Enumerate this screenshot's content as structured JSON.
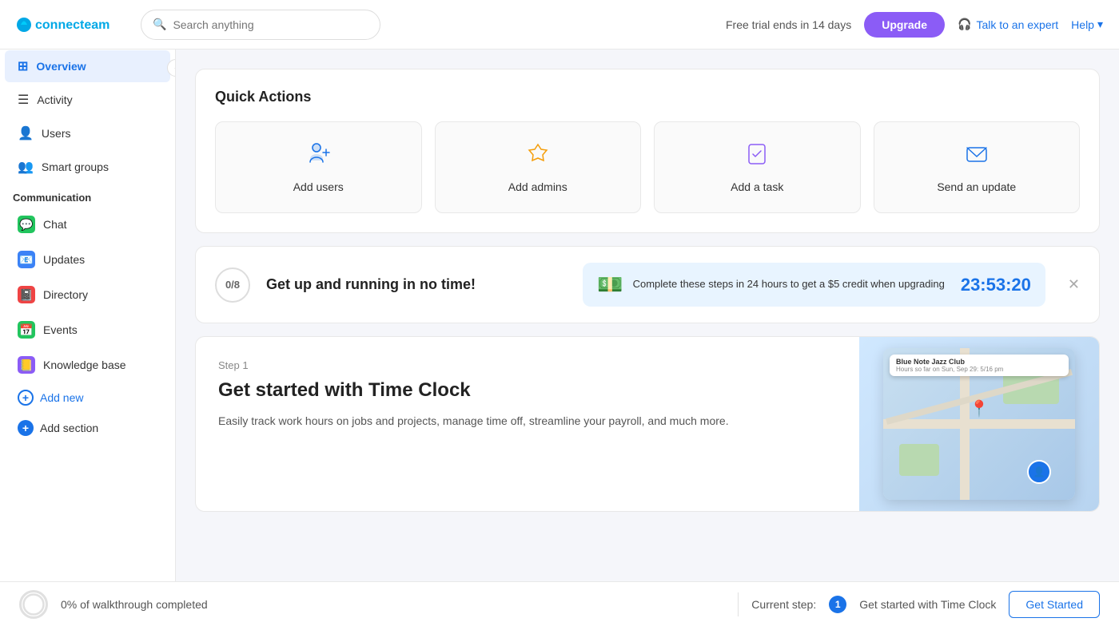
{
  "app": {
    "name": "connecteam",
    "logo_letters": "C"
  },
  "topnav": {
    "search_placeholder": "Search anything",
    "trial_text": "Free trial ends in 14 days",
    "upgrade_label": "Upgrade",
    "talk_expert_label": "Talk to an expert",
    "help_label": "Help"
  },
  "sidebar": {
    "overview_label": "Overview",
    "activity_label": "Activity",
    "users_label": "Users",
    "smart_groups_label": "Smart groups",
    "communication_label": "Communication",
    "chat_label": "Chat",
    "updates_label": "Updates",
    "directory_label": "Directory",
    "events_label": "Events",
    "knowledge_base_label": "Knowledge base",
    "add_new_label": "Add new",
    "add_section_label": "Add section"
  },
  "main": {
    "quick_actions_title": "Quick Actions",
    "quick_actions": [
      {
        "label": "Add users",
        "icon": "👤"
      },
      {
        "label": "Add admins",
        "icon": "👑"
      },
      {
        "label": "Add a task",
        "icon": "✅"
      },
      {
        "label": "Send an update",
        "icon": "✉️"
      }
    ],
    "progress_fraction": "0/8",
    "progress_text": "Get up and running in no time!",
    "credit_text": "Complete these steps in 24 hours to get a $5 credit when upgrading",
    "countdown": "23:53:20",
    "step_label": "Step 1",
    "step_title": "Get started with Time Clock",
    "step_desc": "Easily track work hours on jobs and projects, manage time off, streamline your payroll, and much more."
  },
  "bottombar": {
    "progress_pct": "0%",
    "progress_label": "0% of walkthrough completed",
    "current_step_label": "Current step:",
    "current_step_num": "1",
    "current_step_name": "Get started with Time Clock",
    "get_started_label": "Get Started"
  },
  "colors": {
    "primary": "#1a73e8",
    "upgrade": "#8b5cf6",
    "chat_green": "#22c55e",
    "updates_blue": "#3b82f6",
    "directory_red": "#ef4444",
    "events_green": "#22c55e",
    "kb_purple": "#8b5cf6"
  }
}
